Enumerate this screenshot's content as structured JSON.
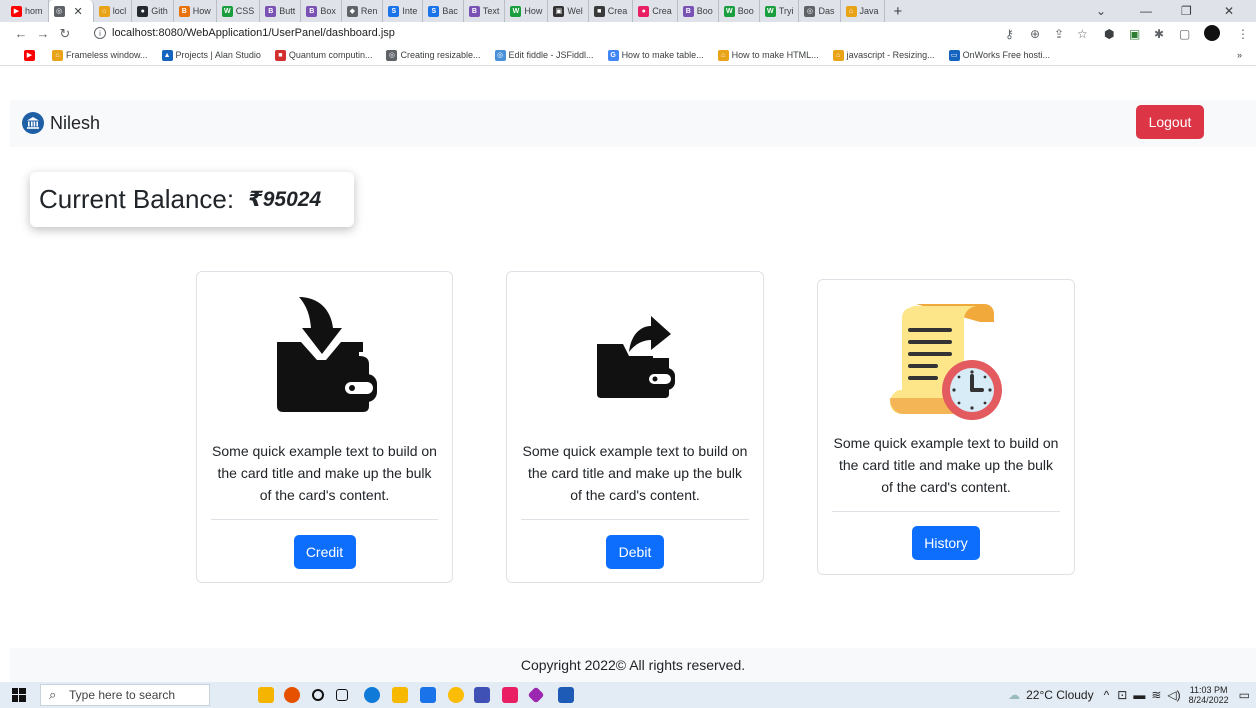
{
  "browser": {
    "tabs": [
      {
        "label": "hom",
        "color": "#ff0000",
        "glyph": "▶"
      },
      {
        "label": "",
        "color": "#5f6368",
        "glyph": "◎",
        "active": true
      },
      {
        "label": "locl",
        "color": "#e8a317",
        "glyph": "⌂"
      },
      {
        "label": "Gith",
        "color": "#24292f",
        "glyph": "●"
      },
      {
        "label": "How",
        "color": "#e8710a",
        "glyph": "B"
      },
      {
        "label": "CSS",
        "color": "#1b9e3e",
        "glyph": "W"
      },
      {
        "label": "Butt",
        "color": "#7952b3",
        "glyph": "B"
      },
      {
        "label": "Box",
        "color": "#7952b3",
        "glyph": "B"
      },
      {
        "label": "Ren",
        "color": "#5f6368",
        "glyph": "◆"
      },
      {
        "label": "Inte",
        "color": "#1a73e8",
        "glyph": "S"
      },
      {
        "label": "Bac",
        "color": "#1a73e8",
        "glyph": "S"
      },
      {
        "label": "Text",
        "color": "#7952b3",
        "glyph": "B"
      },
      {
        "label": "How",
        "color": "#1b9e3e",
        "glyph": "W"
      },
      {
        "label": "Wel",
        "color": "#333333",
        "glyph": "▣"
      },
      {
        "label": "Crea",
        "color": "#3a3a3a",
        "glyph": "■"
      },
      {
        "label": "Crea",
        "color": "#e91e63",
        "glyph": "●"
      },
      {
        "label": "Boo",
        "color": "#7952b3",
        "glyph": "B"
      },
      {
        "label": "Boo",
        "color": "#1b9e3e",
        "glyph": "W"
      },
      {
        "label": "Tryi",
        "color": "#1b9e3e",
        "glyph": "W"
      },
      {
        "label": "Das",
        "color": "#5f6368",
        "glyph": "◎"
      },
      {
        "label": "Java",
        "color": "#e8a317",
        "glyph": "⌂"
      }
    ],
    "url": "localhost:8080/WebApplication1/UserPanel/dashboard.jsp",
    "bookmarks": [
      {
        "label": "",
        "color": "#ff0000",
        "glyph": "▶"
      },
      {
        "label": "Frameless window...",
        "color": "#e8a317",
        "glyph": "⌂"
      },
      {
        "label": "Projects | Alan Studio",
        "color": "#1565c0",
        "glyph": "▲"
      },
      {
        "label": "Quantum computin...",
        "color": "#d32f2f",
        "glyph": "■"
      },
      {
        "label": "Creating resizable...",
        "color": "#5f6368",
        "glyph": "◎"
      },
      {
        "label": "Edit fiddle - JSFiddl...",
        "color": "#4a90d9",
        "glyph": "◎"
      },
      {
        "label": "How to make table...",
        "color": "#4285f4",
        "glyph": "G"
      },
      {
        "label": "How to make HTML...",
        "color": "#e8a317",
        "glyph": "⌂"
      },
      {
        "label": "javascript - Resizing...",
        "color": "#e8a317",
        "glyph": "⌂"
      },
      {
        "label": "OnWorks Free hosti...",
        "color": "#1565c0",
        "glyph": "▭"
      }
    ],
    "bookmarks_more": "»"
  },
  "navbar": {
    "brand": "Nilesh",
    "logout_label": "Logout"
  },
  "balance": {
    "label": "Current Balance:",
    "value": "₹95024"
  },
  "cards": [
    {
      "icon": "wallet-in-icon",
      "text": "Some quick example text to build on the card title and make up the bulk of the card's content.",
      "button": "Credit"
    },
    {
      "icon": "wallet-out-icon",
      "text": "Some quick example text to build on the card title and make up the bulk of the card's content.",
      "button": "Debit"
    },
    {
      "icon": "history-scroll-icon",
      "text": "Some quick example text to build on the card title and make up the bulk of the card's content.",
      "button": "History"
    }
  ],
  "footer": {
    "text": "Copyright 2022© All rights reserved."
  },
  "taskbar": {
    "search_placeholder": "Type here to search",
    "weather": "22°C  Cloudy",
    "time": "11:03 PM",
    "date": "8/24/2022"
  }
}
